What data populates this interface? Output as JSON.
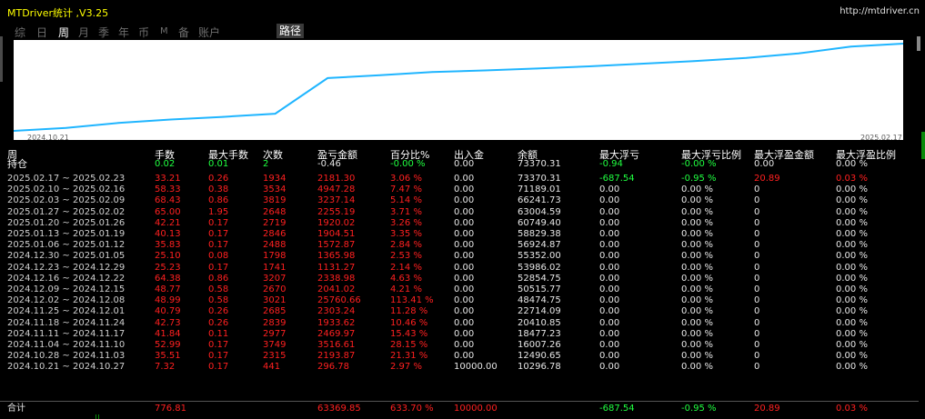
{
  "app": {
    "title": "MTDriver统计 ,V3.25",
    "url": "http://mtdriver.cn"
  },
  "tabs": [
    {
      "label": "综",
      "active": false,
      "small": false
    },
    {
      "label": "日",
      "active": false,
      "small": false
    },
    {
      "label": "周",
      "active": true,
      "small": false
    },
    {
      "label": "月",
      "active": false,
      "small": false
    },
    {
      "label": "季",
      "active": false,
      "small": false
    },
    {
      "label": "年",
      "active": false,
      "small": false
    },
    {
      "label": "币",
      "active": false,
      "small": false
    },
    {
      "label": "M",
      "active": false,
      "small": true
    },
    {
      "label": "备",
      "active": false,
      "small": false
    },
    {
      "label": "账户",
      "active": false,
      "small": false
    }
  ],
  "path_button": "路径",
  "chart_data": {
    "type": "line",
    "x_start": "2024.10.21",
    "x_end": "2025.02.17",
    "x": [
      "2024.10.21",
      "2024.10.28",
      "2024.11.04",
      "2024.11.11",
      "2024.11.18",
      "2024.11.25",
      "2024.12.02",
      "2024.12.09",
      "2024.12.16",
      "2024.12.23",
      "2024.12.30",
      "2025.01.06",
      "2025.01.13",
      "2025.01.20",
      "2025.01.27",
      "2025.02.03",
      "2025.02.10",
      "2025.02.17"
    ],
    "values": [
      10296.78,
      12490.65,
      16007.26,
      18477.23,
      20410.85,
      22714.09,
      48474.75,
      50515.77,
      52854.75,
      53986.02,
      55352.0,
      56924.87,
      58829.38,
      60749.4,
      63004.59,
      66241.73,
      71189.01,
      73370.31
    ],
    "line_color": "#1fb5ff"
  },
  "table": {
    "headers": [
      "周",
      "手数",
      "最大手数",
      "次数",
      "盈亏金额",
      "百分比%",
      "出入金",
      "余额",
      "最大浮亏",
      "最大浮亏比例",
      "最大浮盈金额",
      "最大浮盈比例"
    ],
    "holding": {
      "label": "持仓",
      "values": [
        "0.02",
        "0.01",
        "2",
        "-0.46",
        "-0.00 %",
        "0.00",
        "73370.31",
        "-0.94",
        "-0.00 %",
        "0.00",
        "0.00 %"
      ]
    },
    "rows": [
      {
        "period": "2025.02.17 ~ 2025.02.23",
        "lots": "33.21",
        "max_lots": "0.26",
        "count": "1934",
        "pnl": "2181.30",
        "pct": "3.06 %",
        "flow": "0.00",
        "balance": "73370.31",
        "max_float_loss": "-687.54",
        "max_float_loss_pct": "-0.95 %",
        "max_float_profit": "20.89",
        "max_float_profit_pct": "0.03 %"
      },
      {
        "period": "2025.02.10 ~ 2025.02.16",
        "lots": "58.33",
        "max_lots": "0.38",
        "count": "3534",
        "pnl": "4947.28",
        "pct": "7.47 %",
        "flow": "0.00",
        "balance": "71189.01",
        "max_float_loss": "0.00",
        "max_float_loss_pct": "0.00 %",
        "max_float_profit": "0",
        "max_float_profit_pct": "0.00 %"
      },
      {
        "period": "2025.02.03 ~ 2025.02.09",
        "lots": "68.43",
        "max_lots": "0.86",
        "count": "3819",
        "pnl": "3237.14",
        "pct": "5.14 %",
        "flow": "0.00",
        "balance": "66241.73",
        "max_float_loss": "0.00",
        "max_float_loss_pct": "0.00 %",
        "max_float_profit": "0",
        "max_float_profit_pct": "0.00 %"
      },
      {
        "period": "2025.01.27 ~ 2025.02.02",
        "lots": "65.00",
        "max_lots": "1.95",
        "count": "2648",
        "pnl": "2255.19",
        "pct": "3.71 %",
        "flow": "0.00",
        "balance": "63004.59",
        "max_float_loss": "0.00",
        "max_float_loss_pct": "0.00 %",
        "max_float_profit": "0",
        "max_float_profit_pct": "0.00 %"
      },
      {
        "period": "2025.01.20 ~ 2025.01.26",
        "lots": "42.21",
        "max_lots": "0.17",
        "count": "2719",
        "pnl": "1920.02",
        "pct": "3.26 %",
        "flow": "0.00",
        "balance": "60749.40",
        "max_float_loss": "0.00",
        "max_float_loss_pct": "0.00 %",
        "max_float_profit": "0",
        "max_float_profit_pct": "0.00 %"
      },
      {
        "period": "2025.01.13 ~ 2025.01.19",
        "lots": "40.13",
        "max_lots": "0.17",
        "count": "2846",
        "pnl": "1904.51",
        "pct": "3.35 %",
        "flow": "0.00",
        "balance": "58829.38",
        "max_float_loss": "0.00",
        "max_float_loss_pct": "0.00 %",
        "max_float_profit": "0",
        "max_float_profit_pct": "0.00 %"
      },
      {
        "period": "2025.01.06 ~ 2025.01.12",
        "lots": "35.83",
        "max_lots": "0.17",
        "count": "2488",
        "pnl": "1572.87",
        "pct": "2.84 %",
        "flow": "0.00",
        "balance": "56924.87",
        "max_float_loss": "0.00",
        "max_float_loss_pct": "0.00 %",
        "max_float_profit": "0",
        "max_float_profit_pct": "0.00 %"
      },
      {
        "period": "2024.12.30 ~ 2025.01.05",
        "lots": "25.10",
        "max_lots": "0.08",
        "count": "1798",
        "pnl": "1365.98",
        "pct": "2.53 %",
        "flow": "0.00",
        "balance": "55352.00",
        "max_float_loss": "0.00",
        "max_float_loss_pct": "0.00 %",
        "max_float_profit": "0",
        "max_float_profit_pct": "0.00 %"
      },
      {
        "period": "2024.12.23 ~ 2024.12.29",
        "lots": "25.23",
        "max_lots": "0.17",
        "count": "1741",
        "pnl": "1131.27",
        "pct": "2.14 %",
        "flow": "0.00",
        "balance": "53986.02",
        "max_float_loss": "0.00",
        "max_float_loss_pct": "0.00 %",
        "max_float_profit": "0",
        "max_float_profit_pct": "0.00 %"
      },
      {
        "period": "2024.12.16 ~ 2024.12.22",
        "lots": "64.38",
        "max_lots": "0.86",
        "count": "3207",
        "pnl": "2338.98",
        "pct": "4.63 %",
        "flow": "0.00",
        "balance": "52854.75",
        "max_float_loss": "0.00",
        "max_float_loss_pct": "0.00 %",
        "max_float_profit": "0",
        "max_float_profit_pct": "0.00 %"
      },
      {
        "period": "2024.12.09 ~ 2024.12.15",
        "lots": "48.77",
        "max_lots": "0.58",
        "count": "2670",
        "pnl": "2041.02",
        "pct": "4.21 %",
        "flow": "0.00",
        "balance": "50515.77",
        "max_float_loss": "0.00",
        "max_float_loss_pct": "0.00 %",
        "max_float_profit": "0",
        "max_float_profit_pct": "0.00 %"
      },
      {
        "period": "2024.12.02 ~ 2024.12.08",
        "lots": "48.99",
        "max_lots": "0.58",
        "count": "3021",
        "pnl": "25760.66",
        "pct": "113.41 %",
        "flow": "0.00",
        "balance": "48474.75",
        "max_float_loss": "0.00",
        "max_float_loss_pct": "0.00 %",
        "max_float_profit": "0",
        "max_float_profit_pct": "0.00 %"
      },
      {
        "period": "2024.11.25 ~ 2024.12.01",
        "lots": "40.79",
        "max_lots": "0.26",
        "count": "2685",
        "pnl": "2303.24",
        "pct": "11.28 %",
        "flow": "0.00",
        "balance": "22714.09",
        "max_float_loss": "0.00",
        "max_float_loss_pct": "0.00 %",
        "max_float_profit": "0",
        "max_float_profit_pct": "0.00 %"
      },
      {
        "period": "2024.11.18 ~ 2024.11.24",
        "lots": "42.73",
        "max_lots": "0.26",
        "count": "2839",
        "pnl": "1933.62",
        "pct": "10.46 %",
        "flow": "0.00",
        "balance": "20410.85",
        "max_float_loss": "0.00",
        "max_float_loss_pct": "0.00 %",
        "max_float_profit": "0",
        "max_float_profit_pct": "0.00 %"
      },
      {
        "period": "2024.11.11 ~ 2024.11.17",
        "lots": "41.84",
        "max_lots": "0.11",
        "count": "2977",
        "pnl": "2469.97",
        "pct": "15.43 %",
        "flow": "0.00",
        "balance": "18477.23",
        "max_float_loss": "0.00",
        "max_float_loss_pct": "0.00 %",
        "max_float_profit": "0",
        "max_float_profit_pct": "0.00 %"
      },
      {
        "period": "2024.11.04 ~ 2024.11.10",
        "lots": "52.99",
        "max_lots": "0.17",
        "count": "3749",
        "pnl": "3516.61",
        "pct": "28.15 %",
        "flow": "0.00",
        "balance": "16007.26",
        "max_float_loss": "0.00",
        "max_float_loss_pct": "0.00 %",
        "max_float_profit": "0",
        "max_float_profit_pct": "0.00 %"
      },
      {
        "period": "2024.10.28 ~ 2024.11.03",
        "lots": "35.51",
        "max_lots": "0.17",
        "count": "2315",
        "pnl": "2193.87",
        "pct": "21.31 %",
        "flow": "0.00",
        "balance": "12490.65",
        "max_float_loss": "0.00",
        "max_float_loss_pct": "0.00 %",
        "max_float_profit": "0",
        "max_float_profit_pct": "0.00 %"
      },
      {
        "period": "2024.10.21 ~ 2024.10.27",
        "lots": "7.32",
        "max_lots": "0.17",
        "count": "441",
        "pnl": "296.78",
        "pct": "2.97 %",
        "flow": "10000.00",
        "balance": "10296.78",
        "max_float_loss": "0.00",
        "max_float_loss_pct": "0.00 %",
        "max_float_profit": "0",
        "max_float_profit_pct": "0.00 %"
      }
    ],
    "total": {
      "label": "合计",
      "lots": "776.81",
      "pnl": "63369.85",
      "pct": "633.70 %",
      "flow": "10000.00",
      "max_float_loss": "-687.54",
      "max_float_loss_pct": "-0.95 %",
      "max_float_profit": "20.89",
      "max_float_profit_pct": "0.03 %"
    }
  }
}
